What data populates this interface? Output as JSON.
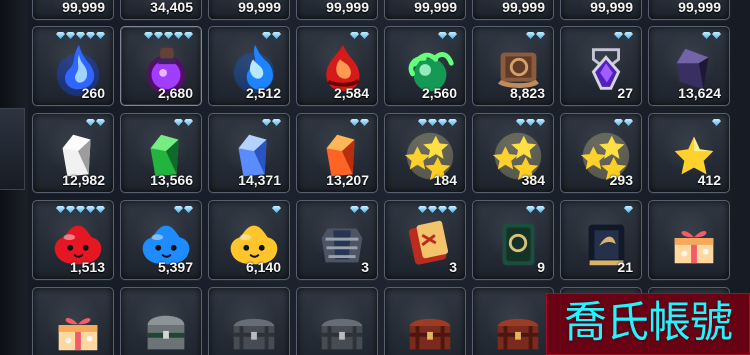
{
  "top_counts": [
    "99,999",
    "34,405",
    "99,999",
    "99,999",
    "99,999",
    "99,999",
    "99,999",
    "99,999"
  ],
  "inventory": [
    [
      {
        "count": "260",
        "icon": "blue-flame-icon",
        "gems": 5
      },
      {
        "count": "2,680",
        "icon": "purple-potion-icon",
        "gems": 5
      },
      {
        "count": "2,512",
        "icon": "blue-essence-icon",
        "gems": 2
      },
      {
        "count": "2,584",
        "icon": "red-essence-icon",
        "gems": 2
      },
      {
        "count": "2,560",
        "icon": "green-orb-icon",
        "gems": 2
      },
      {
        "count": "8,823",
        "icon": "scroll-icon",
        "gems": 2
      },
      {
        "count": "27",
        "icon": "purple-amulet-icon",
        "gems": 2
      },
      {
        "count": "13,624",
        "icon": "dark-crystal-icon",
        "gems": 2
      }
    ],
    [
      {
        "count": "12,982",
        "icon": "white-crystal-icon",
        "gems": 2
      },
      {
        "count": "13,566",
        "icon": "green-crystal-icon",
        "gems": 2
      },
      {
        "count": "14,371",
        "icon": "blue-crystal-icon",
        "gems": 2
      },
      {
        "count": "13,207",
        "icon": "red-crystal-icon",
        "gems": 2
      },
      {
        "count": "184",
        "icon": "gold-stars-icon",
        "gems": 4
      },
      {
        "count": "384",
        "icon": "gold-stars-icon",
        "gems": 3
      },
      {
        "count": "293",
        "icon": "gold-stars-icon",
        "gems": 2
      },
      {
        "count": "412",
        "icon": "gold-star-icon",
        "gems": 1
      }
    ],
    [
      {
        "count": "1,513",
        "icon": "red-slime-icon",
        "gems": 5
      },
      {
        "count": "5,397",
        "icon": "blue-slime-icon",
        "gems": 2
      },
      {
        "count": "6,140",
        "icon": "gold-slime-icon",
        "gems": 1
      },
      {
        "count": "3",
        "icon": "armor-icon",
        "gems": 2
      },
      {
        "count": "3",
        "icon": "red-book-icon",
        "gems": 4
      },
      {
        "count": "9",
        "icon": "green-book-icon",
        "gems": 2
      },
      {
        "count": "21",
        "icon": "black-book-icon",
        "gems": 1
      },
      {
        "count": "",
        "icon": "gift-box-icon",
        "gems": 0
      }
    ],
    [
      {
        "count": "",
        "icon": "gift-box-icon",
        "gems": 0
      },
      {
        "count": "",
        "icon": "green-chest-icon",
        "gems": 0
      },
      {
        "count": "",
        "icon": "steel-chest-icon",
        "gems": 0
      },
      {
        "count": "",
        "icon": "steel-chest-icon",
        "gems": 0
      },
      {
        "count": "",
        "icon": "red-chest-icon",
        "gems": 0
      },
      {
        "count": "",
        "icon": "red-chest-icon",
        "gems": 0
      },
      {
        "count": "",
        "icon": "",
        "gems": 0
      },
      {
        "count": "",
        "icon": "",
        "gems": 0
      }
    ]
  ],
  "watermark": "喬氏帳號"
}
